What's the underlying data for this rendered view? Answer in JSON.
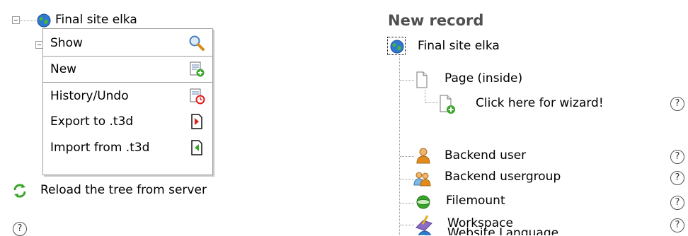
{
  "tree": {
    "root_label": "Final site elka",
    "reload_label": "Reload the tree from server"
  },
  "context_menu": {
    "items": [
      {
        "label": "Show",
        "icon": "magnifier-icon"
      },
      {
        "label": "New",
        "icon": "new-record-icon"
      },
      {
        "label": "History/Undo",
        "icon": "history-icon"
      },
      {
        "label": "Export to .t3d",
        "icon": "export-icon"
      },
      {
        "label": "Import from .t3d",
        "icon": "import-icon"
      }
    ]
  },
  "new_record": {
    "title": "New record",
    "root_label": "Final site elka",
    "items": [
      {
        "label": "Page (inside)",
        "icon": "page-icon"
      },
      {
        "label": "Click here for wizard!",
        "icon": "page-wizard-icon"
      },
      {
        "label": "Backend user",
        "icon": "backend-user-icon"
      },
      {
        "label": "Backend usergroup",
        "icon": "backend-usergroup-icon"
      },
      {
        "label": "Filemount",
        "icon": "filemount-icon"
      },
      {
        "label": "Workspace",
        "icon": "workspace-icon"
      },
      {
        "label": "Website Language",
        "icon": "website-language-icon"
      }
    ]
  },
  "colors": {
    "accent_red": "#e31b1b",
    "accent_green": "#3aa62a",
    "border": "#9e9e9e"
  }
}
